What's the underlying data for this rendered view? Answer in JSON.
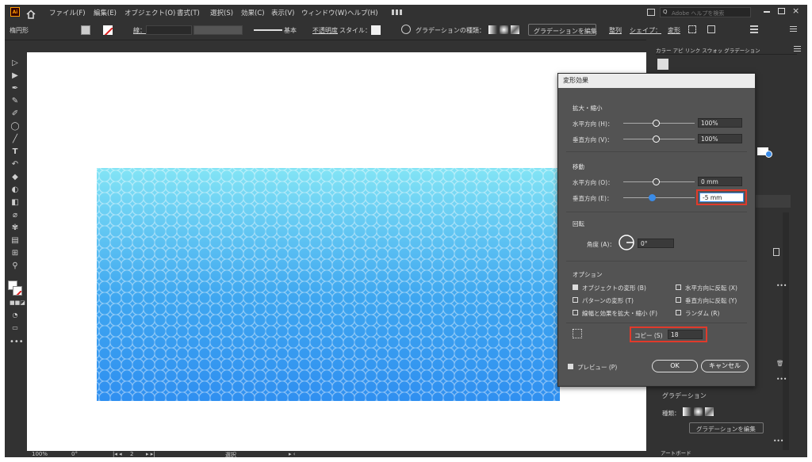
{
  "menubar": {
    "logo": "Ai",
    "items": [
      "ファイル(F)",
      "編集(E)",
      "オブジェクト(O)",
      "書式(T)",
      "選択(S)",
      "効果(C)",
      "表示(V)",
      "ウィンドウ(W)",
      "ヘルプ(H)"
    ],
    "search_placeholder": "Adobe ヘルプを検索"
  },
  "controlbar": {
    "object_type": "楕円形",
    "stroke_label": "線：",
    "stroke_style": "基本",
    "opacity_label": "不透明度",
    "style_label": "スタイル：",
    "gradient_type_label": "グラデーションの種類：",
    "edit_gradient": "グラデーションを編集",
    "align": "整列",
    "shape": "シェイプ：",
    "transform": "変形"
  },
  "statusbar": {
    "zoom": "100%",
    "rotation": "0°",
    "artboard": "2",
    "tool": "選択"
  },
  "right_panel": {
    "tabs": "カラー アピ リンク スウォッ グラデーション",
    "gradient_title": "グラデーション",
    "gradient_type_label": "種類：",
    "edit_gradient_button": "グラデーションを編集",
    "artboard_tab": "アートボード"
  },
  "dialog": {
    "title": "変形効果",
    "scale_section": "拡大・縮小",
    "scale_h_label": "水平方向 (H)：",
    "scale_h_value": "100%",
    "scale_v_label": "垂直方向 (V)：",
    "scale_v_value": "100%",
    "move_section": "移動",
    "move_h_label": "水平方向 (O)：",
    "move_h_value": "0 mm",
    "move_v_label": "垂直方向 (E)：",
    "move_v_value": "-5 mm",
    "rotate_section": "回転",
    "angle_label": "角度 (A)：",
    "angle_value": "0°",
    "options_section": "オプション",
    "opt_transform_objects": "オブジェクトの変形 (B)",
    "opt_transform_patterns": "パターンの変形 (T)",
    "opt_scale_strokes": "線幅と効果を拡大・縮小 (F)",
    "opt_reflect_x": "水平方向に反転 (X)",
    "opt_reflect_y": "垂直方向に反転 (Y)",
    "opt_random": "ランダム (R)",
    "copies_label": "コピー (S)",
    "copies_value": "18",
    "preview_label": "プレビュー (P)",
    "ok_label": "OK",
    "cancel_label": "キャンセル"
  },
  "colors": {
    "gradient_top": "#83e4f5",
    "gradient_bottom": "#2f8ff0",
    "highlight": "#e03a2b",
    "accent": "#3b8ce8"
  }
}
